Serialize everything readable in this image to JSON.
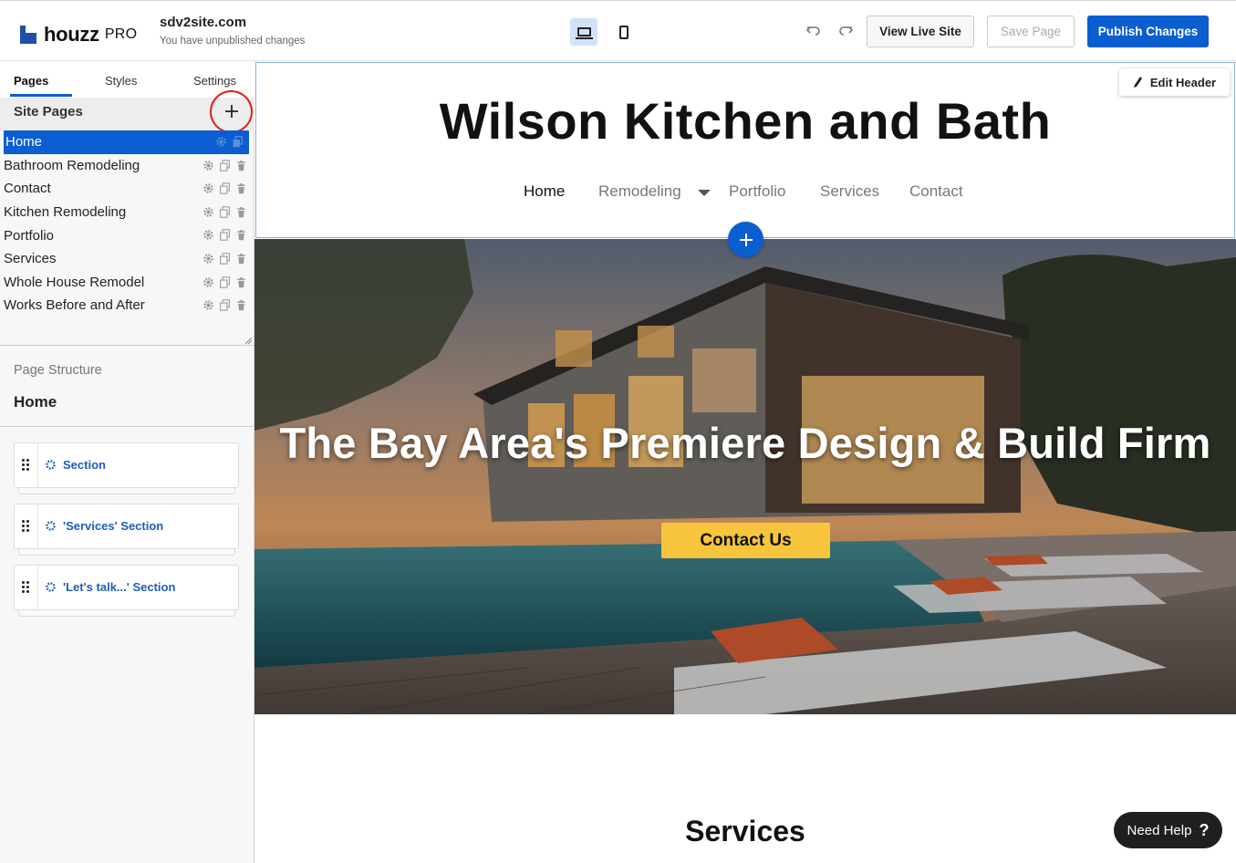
{
  "app": {
    "logo_word": "houzz",
    "logo_suffix": "PRO",
    "site_name": "sdv2site.com",
    "site_status": "You have unpublished changes"
  },
  "toolbar": {
    "desktop_icon": "laptop-icon",
    "mobile_icon": "phone-icon",
    "undo_icon": "undo-icon",
    "redo_icon": "redo-icon",
    "view_live_label": "View Live Site",
    "save_label": "Save Page",
    "publish_label": "Publish Changes"
  },
  "sidebar": {
    "tabs": [
      {
        "label": "Pages",
        "active": true
      },
      {
        "label": "Styles",
        "active": false
      },
      {
        "label": "Settings",
        "active": false
      }
    ],
    "site_pages_title": "Site Pages",
    "add_page_icon": "plus-icon",
    "pages": [
      {
        "label": "Home",
        "active": true
      },
      {
        "label": "Bathroom Remodeling",
        "active": false
      },
      {
        "label": "Contact",
        "active": false
      },
      {
        "label": "Kitchen Remodeling",
        "active": false
      },
      {
        "label": "Portfolio",
        "active": false
      },
      {
        "label": "Services",
        "active": false
      },
      {
        "label": "Whole House Remodel",
        "active": false
      },
      {
        "label": "Works Before and After",
        "active": false
      }
    ],
    "page_structure_label": "Page Structure",
    "page_structure_page": "Home",
    "sections": [
      {
        "label": "Section"
      },
      {
        "label": "'Services' Section"
      },
      {
        "label": "'Let's talk...' Section"
      }
    ]
  },
  "canvas": {
    "edit_header_label": "Edit Header",
    "site_title": "Wilson Kitchen and Bath",
    "nav": [
      {
        "label": "Home",
        "active": true
      },
      {
        "label": "Remodeling",
        "active": false,
        "has_dropdown": true
      },
      {
        "label": "Portfolio",
        "active": false
      },
      {
        "label": "Services",
        "active": false
      },
      {
        "label": "Contact",
        "active": false
      }
    ],
    "hero_title": "The Bay Area's Premiere Design & Build Firm",
    "hero_cta": "Contact Us",
    "services_heading": "Services"
  },
  "help": {
    "label": "Need Help",
    "icon": "?"
  },
  "colors": {
    "brand_blue": "#0b5ecf",
    "highlight_ring": "#e11e1e",
    "cta_yellow": "#f7c53b"
  }
}
